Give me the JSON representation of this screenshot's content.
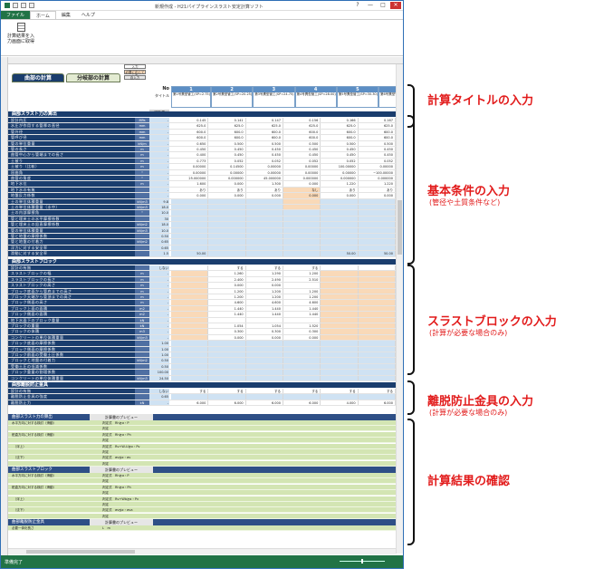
{
  "window": {
    "title": "新規作成 - H21パイプラインスラスト安定計算ソフト",
    "controls": [
      "?",
      "—",
      "□",
      "✕"
    ]
  },
  "ribbon": {
    "tabs": [
      "ファイル",
      "ホーム",
      "編集",
      "ヘルプ"
    ],
    "button_label": "計算結果を入\n力画面に取得"
  },
  "sheet": {
    "tab1": "曲部の計算",
    "tab2": "分岐部の計算",
    "legend": [
      "入力",
      "必要に応じて入力",
      "自入力"
    ],
    "note": "をクリックすると計算書がプレビューされます",
    "no_label": "No",
    "title_label": "タイトル",
    "std_label": "標準値",
    "cols": [
      {
        "no": "1",
        "title": "第1号異型管工(SP=2.75)"
      },
      {
        "no": "2",
        "title": "第2号異型管工(SP=20.25)"
      },
      {
        "no": "3",
        "title": "第3号異型管工(SP=24.75)"
      },
      {
        "no": "4",
        "title": "第4号異型管工(SP=28.00)"
      },
      {
        "no": "5",
        "title": "第5号異型管工(SP=30.30)"
      },
      {
        "no": "6",
        "title": "第6号異型管工(SP=33.30)"
      }
    ],
    "sec1": "曲部スラスト力の算出",
    "sec2": "曲部スラストブロック",
    "sec3": "曲部離脱防止金具",
    "rows1": [
      {
        "l": "設計内圧",
        "u": "MPa",
        "s": "-",
        "c": [
          "0.145",
          "0.141",
          "0.147",
          "0.156",
          "0.166",
          "0.167"
        ]
      },
      {
        "l": "水圧が作用する管厚の直径",
        "u": "mm",
        "s": "-",
        "c": [
          "625.0",
          "625.0",
          "625.0",
          "625.0",
          "625.0",
          "625.0"
        ]
      },
      {
        "l": "管外径",
        "u": "mm",
        "s": "-",
        "c": [
          "600.0",
          "600.0",
          "600.0",
          "600.0",
          "600.0",
          "600.0"
        ]
      },
      {
        "l": "管呼び径",
        "u": "mm",
        "s": "-",
        "c": [
          "600.0",
          "600.0",
          "600.0",
          "600.0",
          "600.0",
          "600.0"
        ]
      },
      {
        "l": "管の単位重量",
        "u": "kN/m",
        "s": "-",
        "c": [
          "0.650",
          "0.500",
          "0.500",
          "0.500",
          "0.500",
          "0.500"
        ]
      },
      {
        "l": "管の長さ",
        "u": "m",
        "s": "-",
        "c": [
          "0.450",
          "0.450",
          "0.450",
          "0.450",
          "0.450",
          "0.450"
        ]
      },
      {
        "l": "曲管中心から管端までの長さ",
        "u": "m",
        "s": "-",
        "c": [
          "0.400",
          "0.450",
          "0.450",
          "0.450",
          "0.450",
          "0.450"
        ]
      },
      {
        "l": "土被り",
        "u": "m",
        "s": "-",
        "c": [
          "0.773",
          "0.052",
          "0.052",
          "0.052",
          "0.052",
          "0.052"
        ]
      },
      {
        "l": "土被り（比較）",
        "u": "m",
        "s": "-",
        "c": [
          "0.00000",
          "0.14500",
          "0.00000",
          "0.00000",
          "100.00000",
          "0.00000"
        ]
      },
      {
        "l": "屈曲角",
        "u": "°",
        "s": "-",
        "c": [
          "0.00000",
          "0.00000",
          "0.00000",
          "0.00000",
          "0.00000",
          "−100.00000"
        ]
      },
      {
        "l": "曲管の角度",
        "u": "°",
        "s": "-",
        "c": [
          "25.000000",
          "0.000000",
          "45.000000",
          "0.000000",
          "0.000000",
          "0.000000"
        ]
      },
      {
        "l": "地下水位",
        "u": "m",
        "s": "-",
        "c": [
          "1.600",
          "0.000",
          "1.300",
          "0.000",
          "1.220",
          "1.220"
        ]
      },
      {
        "l": "地下水の有無",
        "u": "",
        "s": "-",
        "c": [
          "あり",
          "あり",
          "あり",
          "なし",
          "あり",
          "あり"
        ]
      },
      {
        "l": "地盤反力係数",
        "u": "",
        "s": "-",
        "c": [
          "0.000",
          "0.000",
          "0.000",
          "0.000",
          "0.000",
          "0.000"
        ]
      },
      {
        "l": "土の単位体積重量",
        "u": "kN/m3",
        "s": "9.8",
        "c": [
          "",
          "",
          "",
          "",
          "",
          ""
        ]
      },
      {
        "l": "土の単位体積重量（水中）",
        "u": "kN/m3",
        "s": "18.0",
        "c": [
          "",
          "",
          "",
          "",
          "",
          ""
        ]
      },
      {
        "l": "土の内部摩擦角",
        "u": "°",
        "s": "10.0",
        "c": [
          "",
          "",
          "",
          "",
          "",
          ""
        ]
      },
      {
        "l": "管と埋戻土の水平摩擦係数",
        "u": "",
        "s": "30",
        "c": [
          "",
          "",
          "",
          "",
          "",
          ""
        ]
      },
      {
        "l": "管と埋戻土の鉛直摩擦係数",
        "u": "kN/m2",
        "s": "18.0",
        "c": [
          "",
          "",
          "",
          "",
          "",
          ""
        ]
      },
      {
        "l": "管の単位体積重量",
        "u": "kN/m3",
        "s": "10.0",
        "c": [
          "",
          "",
          "",
          "",
          "",
          ""
        ]
      },
      {
        "l": "管と地盤の摩擦係数",
        "u": "",
        "s": "0.50",
        "c": [
          "",
          "",
          "",
          "",
          "",
          ""
        ]
      },
      {
        "l": "管と地盤の付着力",
        "u": "kN/m2",
        "s": "0.65",
        "c": [
          "",
          "",
          "",
          "",
          "",
          ""
        ]
      },
      {
        "l": "浮力に対する安全率",
        "u": "",
        "s": "0.65",
        "c": [
          "",
          "",
          "",
          "",
          "",
          ""
        ]
      },
      {
        "l": "滑動に対する安全率",
        "u": "",
        "s": "1.5",
        "c": [
          "50.00",
          "",
          "",
          "",
          "50.00",
          "50.00"
        ]
      }
    ],
    "rows2": [
      {
        "l": "設計の有無",
        "u": "",
        "s": "しない",
        "c": [
          "",
          "する",
          "する",
          "する",
          "",
          ""
        ]
      },
      {
        "l": "スラストブロックの幅",
        "u": "m",
        "s": "-",
        "c": [
          "",
          "1.260",
          "1.290",
          "1.200",
          "",
          ""
        ]
      },
      {
        "l": "スラストブロックの長さ",
        "u": "m",
        "s": "-",
        "c": [
          "",
          "2.400",
          "2.490",
          "2.510",
          "",
          ""
        ]
      },
      {
        "l": "スラストブロックの高さ",
        "u": "m",
        "s": "-",
        "c": [
          "",
          "0.000",
          "0.000",
          "",
          "",
          ""
        ]
      },
      {
        "l": "ブロック底面から管底までの高さ",
        "u": "m",
        "s": "-",
        "c": [
          "",
          "1.200",
          "1.200",
          "1.200",
          "",
          ""
        ]
      },
      {
        "l": "ブロック天端から管頂までの高さ",
        "u": "m",
        "s": "-",
        "c": [
          "",
          "1.200",
          "1.200",
          "1.200",
          "",
          ""
        ]
      },
      {
        "l": "ブロック側面の高さ",
        "u": "m",
        "s": "-",
        "c": [
          "",
          "4.600",
          "4.600",
          "4.600",
          "",
          ""
        ]
      },
      {
        "l": "ブロック上面の面積",
        "u": "m2",
        "s": "-",
        "c": [
          "",
          "1.440",
          "1.440",
          "1.440",
          "",
          ""
        ]
      },
      {
        "l": "ブロック側面の面積",
        "u": "m2",
        "s": "-",
        "c": [
          "",
          "1.440",
          "1.440",
          "1.440",
          "",
          ""
        ]
      },
      {
        "l": "地下水面下のブロック重量",
        "u": "kN",
        "s": "-",
        "c": [
          "",
          "",
          "",
          "",
          "",
          ""
        ]
      },
      {
        "l": "ブロックの重量",
        "u": "kN",
        "s": "-",
        "c": [
          "",
          "1.054",
          "1.054",
          "1.520",
          "",
          ""
        ]
      },
      {
        "l": "ブロックの体積",
        "u": "m3",
        "s": "-",
        "c": [
          "",
          "0.300",
          "0.300",
          "0.300",
          "",
          ""
        ]
      },
      {
        "l": "コンクリートの単位体積重量",
        "u": "kN/m3",
        "s": "-",
        "c": [
          "",
          "0.000",
          "0.000",
          "0.000",
          "",
          ""
        ]
      },
      {
        "l": "ブロック底面の摩擦係数",
        "u": "",
        "s": "1.00",
        "c": [
          "",
          "",
          "",
          "",
          "",
          ""
        ]
      },
      {
        "l": "ブロック側面の摩擦係数",
        "u": "",
        "s": "1.00",
        "c": [
          "",
          "",
          "",
          "",
          "",
          ""
        ]
      },
      {
        "l": "ブロック前面の受働土圧係数",
        "u": "",
        "s": "1.00",
        "c": [
          "",
          "",
          "",
          "",
          "",
          ""
        ]
      },
      {
        "l": "ブロックと地盤の付着力",
        "u": "kN/m2",
        "s": "0.50",
        "c": [
          "",
          "",
          "",
          "",
          "",
          ""
        ]
      },
      {
        "l": "受働土圧の低減係数",
        "u": "",
        "s": "0.50",
        "c": [
          "",
          "",
          "",
          "",
          "",
          ""
        ]
      },
      {
        "l": "ブロック重量の割増係数",
        "u": "",
        "s": "100.00",
        "c": [
          "",
          "",
          "",
          "",
          "",
          ""
        ]
      },
      {
        "l": "コンクリートの単位体積重量",
        "u": "kN/m3",
        "s": "24.50",
        "c": [
          "",
          "",
          "",
          "",
          "",
          ""
        ]
      }
    ],
    "rows3": [
      {
        "l": "設計の有無",
        "u": "",
        "s": "しない",
        "c": [
          "する",
          "する",
          "する",
          "する",
          "する",
          "する"
        ]
      },
      {
        "l": "離脱防止金具の強度",
        "u": "",
        "s": "0.65",
        "c": [
          "",
          "",
          "",
          "",
          "",
          ""
        ]
      },
      {
        "l": "離脱防止力",
        "u": "kN",
        "s": "-",
        "c": [
          "6.000",
          "6.000",
          "6.000",
          "6.000",
          "4.000",
          "6.000"
        ]
      }
    ],
    "res1": "曲部スラスト力の算出",
    "res2": "曲部スラストブロック",
    "res3": "曲部離脱防止金具",
    "preview": "計算書のプレビュー",
    "res1_rows": [
      {
        "l": "水平方向に対する検討（滑動）",
        "f": "判定式　Rh≧α・P"
      },
      {
        "l": "",
        "f": "判定"
      },
      {
        "l": "鉛直方向に対する検討（滑動）",
        "f": "判定式　Rh≧α・Ph"
      },
      {
        "l": "",
        "f": "判定"
      },
      {
        "l": "　（浮上）",
        "f": "判定式　Rv+W-U≧α・Pv"
      },
      {
        "l": "",
        "f": "判定"
      },
      {
        "l": "　（沈下）",
        "f": "判定式　σv≦α・σv"
      },
      {
        "l": "",
        "f": "判定"
      }
    ],
    "res2_rows": [
      {
        "l": "水平方向に対する検討（滑動）",
        "f": "判定式　Rh≧α・P"
      },
      {
        "l": "",
        "f": "判定"
      },
      {
        "l": "鉛直方向に対する検討（滑動）",
        "f": "判定式　Rh≧α・Ph"
      },
      {
        "l": "",
        "f": "判定"
      },
      {
        "l": "　（浮上）",
        "f": "判定式　Rv+Wb≧α・Pv"
      },
      {
        "l": "",
        "f": "判定"
      },
      {
        "l": "　（沈下）",
        "f": "判定式　σv≦α・σva"
      },
      {
        "l": "",
        "f": "判定"
      }
    ],
    "res3_rows": [
      {
        "l": "必要一体化長さ",
        "f": "L　m"
      }
    ]
  },
  "status": {
    "text": "準備完了"
  },
  "annotations": [
    {
      "main": "計算タイトルの入力",
      "sub": ""
    },
    {
      "main": "基本条件の入力",
      "sub": "(管径や土質条件など)"
    },
    {
      "main": "スラストブロックの入力",
      "sub": "(計算が必要な場合のみ)"
    },
    {
      "main": "離脱防止金具の入力",
      "sub": "(計算が必要な場合のみ)"
    },
    {
      "main": "計算結果の確認",
      "sub": ""
    }
  ]
}
